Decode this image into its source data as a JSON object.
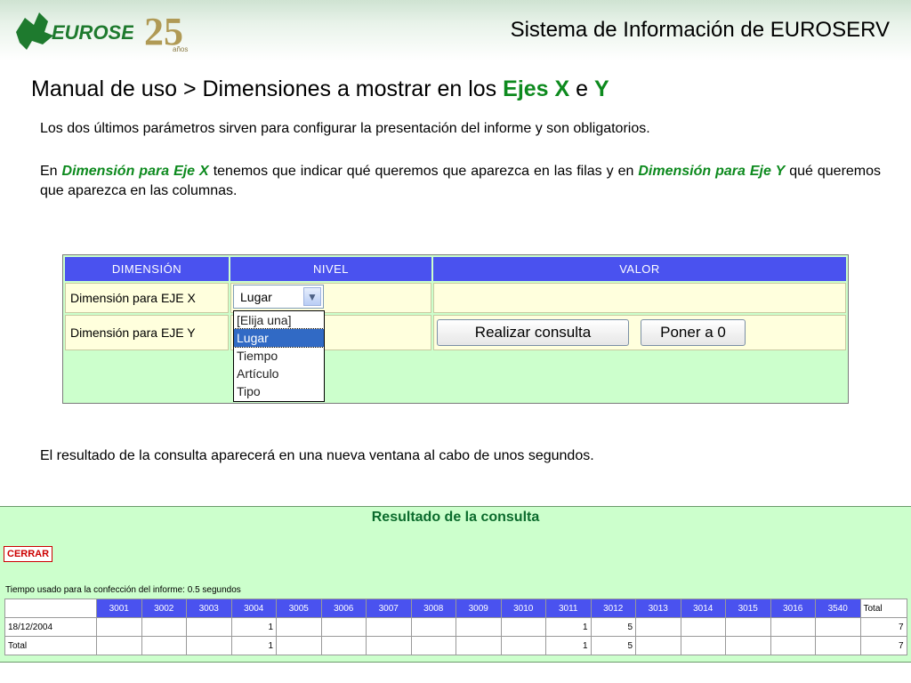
{
  "header": {
    "logo_euroserv": "EUROSERV",
    "logo_25": "25",
    "logo_25_sub": "años",
    "system_title": "Sistema de Información de EUROSERV"
  },
  "page_title": {
    "prefix": "Manual de uso > Dimensiones a mostrar en los ",
    "ejes_x": "Ejes X",
    "and": " e ",
    "y": "Y"
  },
  "paragraphs": {
    "p1": "Los dos últimos parámetros sirven para configurar la presentación del informe y son obligatorios.",
    "p2_a": "En ",
    "p2_b": "Dimensión para Eje X",
    "p2_c": " tenemos que indicar qué queremos que aparezca en las filas y en ",
    "p2_d": "Dimensión para Eje Y",
    "p2_e": " qué queremos que aparezca en las columnas.",
    "p3": "El resultado de la consulta aparecerá en una nueva ventana al cabo de unos segundos."
  },
  "form": {
    "headers": [
      "DIMENSIÓN",
      "NIVEL",
      "VALOR"
    ],
    "row_x_label": "Dimensión para EJE X",
    "row_y_label": "Dimensión para EJE Y",
    "select_value": "Lugar",
    "dropdown_options": [
      "[Elija una]",
      "Lugar",
      "Tiempo",
      "Artículo",
      "Tipo"
    ],
    "btn_query": "Realizar consulta",
    "btn_reset": "Poner a 0"
  },
  "result": {
    "title": "Resultado de la consulta",
    "close_label": "CERRAR",
    "time_info": "Tiempo usado para la confección del informe: 0.5 segundos",
    "columns": [
      "3001",
      "3002",
      "3003",
      "3004",
      "3005",
      "3006",
      "3007",
      "3008",
      "3009",
      "3010",
      "3011",
      "3012",
      "3013",
      "3014",
      "3015",
      "3016",
      "3540"
    ],
    "total_label": "Total",
    "rows": [
      {
        "label": "18/12/2004",
        "cells": [
          "",
          "",
          "",
          "1",
          "",
          "",
          "",
          "",
          "",
          "",
          "1",
          "5",
          "",
          "",
          "",
          "",
          ""
        ],
        "total": "7"
      },
      {
        "label": "Total",
        "cells": [
          "",
          "",
          "",
          "1",
          "",
          "",
          "",
          "",
          "",
          "",
          "1",
          "5",
          "",
          "",
          "",
          "",
          ""
        ],
        "total": "7"
      }
    ]
  },
  "colors": {
    "accent_blue": "#4a52ef",
    "green_text": "#0d8a1e",
    "result_bg": "#ccffcc"
  }
}
